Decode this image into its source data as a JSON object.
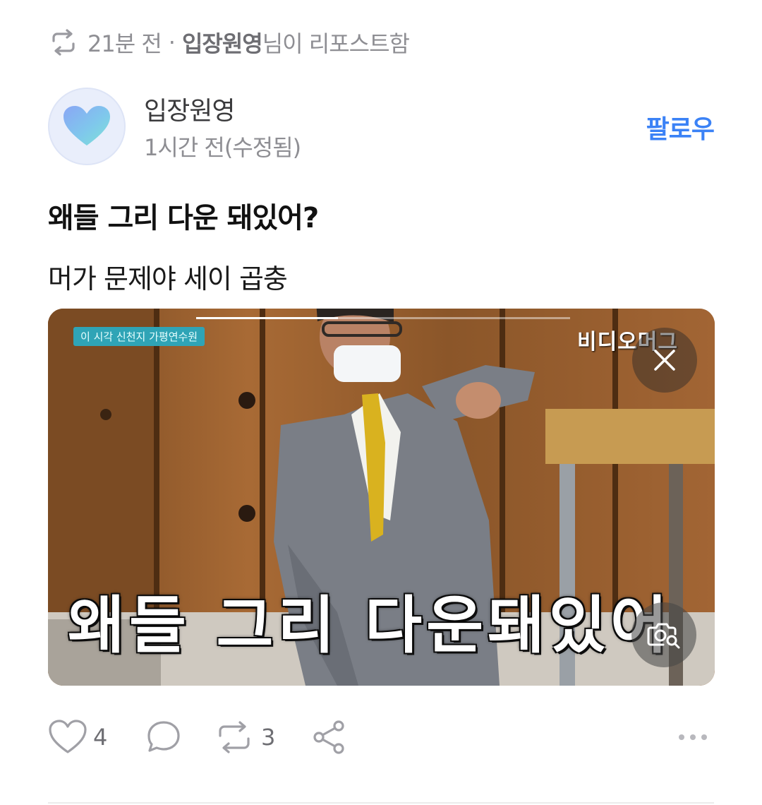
{
  "repost": {
    "icon": "repost-icon",
    "time": "21분 전",
    "separator": "·",
    "user": "입장원영",
    "suffix": "님이 리포스트함"
  },
  "author": {
    "name": "입장원영",
    "time": "1시간 전(수정됨)",
    "avatar_icon": "blue-heart-icon",
    "follow_label": "팔로우"
  },
  "post": {
    "title": "왜들 그리 다운 돼있어?",
    "body": "머가 문제야 세이 곱충"
  },
  "media": {
    "subtitle": "왜들 그리 다운돼있어",
    "news_tag": "이 시각 신천지 가평연수원",
    "brand": "비디오머그",
    "progress": 0.38,
    "close_icon": "close-icon",
    "lens_icon": "image-search-icon"
  },
  "actions": {
    "likes": "4",
    "reposts": "3",
    "like_icon": "heart-icon",
    "comment_icon": "comment-icon",
    "repost_icon": "repost-icon",
    "share_icon": "share-icon",
    "more_icon": "more-icon"
  },
  "colors": {
    "accent": "#3b82f6",
    "muted": "#8e8e93",
    "text": "#1a1a1a"
  }
}
